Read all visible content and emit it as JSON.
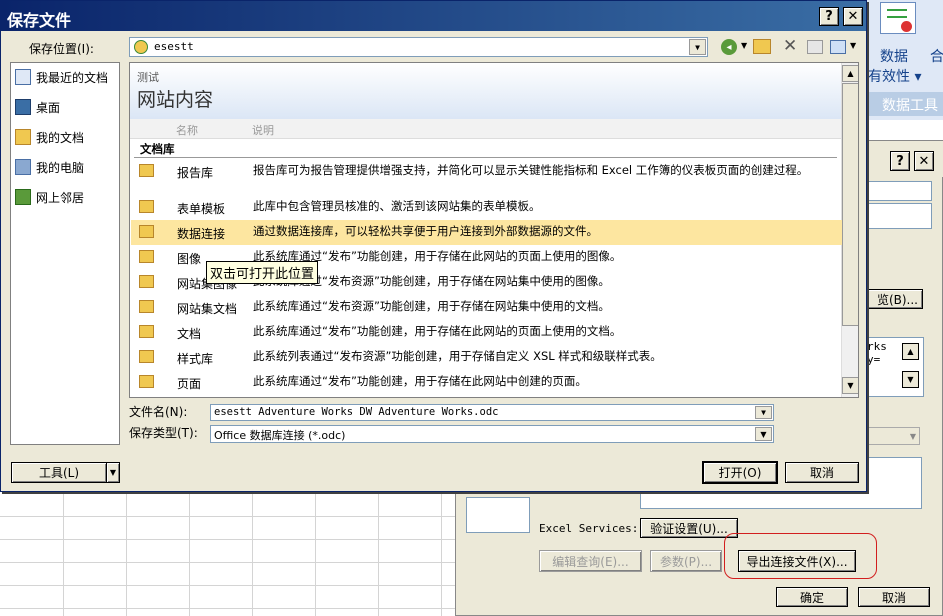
{
  "dialog": {
    "title": "保存文件",
    "help_label": "?",
    "close_label": "✕"
  },
  "save_location": {
    "label": "保存位置(I):",
    "value": "esestt"
  },
  "places": [
    "我最近的文档",
    "桌面",
    "我的文档",
    "我的电脑",
    "网上邻居"
  ],
  "site": {
    "caption": "测试",
    "title": "网站内容",
    "col_name": "名称",
    "col_desc": "说明",
    "section": "文档库"
  },
  "libraries": [
    {
      "name": "报告库",
      "desc": "报告库可为报告管理提供增强支持，并简化可以显示关键性能指标和 Excel 工作簿的仪表板页面的创建过程。"
    },
    {
      "name": "表单模板",
      "desc": "此库中包含管理员核准的、激活到该网站集的表单模板。"
    },
    {
      "name": "数据连接",
      "desc": "通过数据连接库，可以轻松共享便于用户连接到外部数据源的文件。"
    },
    {
      "name": "图像",
      "desc": "此系统库通过“发布”功能创建，用于存储在此网站的页面上使用的图像。"
    },
    {
      "name": "网站集图像",
      "desc": "此系统库通过“发布资源”功能创建，用于存储在网站集中使用的图像。"
    },
    {
      "name": "网站集文档",
      "desc": "此系统库通过“发布资源”功能创建，用于存储在网站集中使用的文档。"
    },
    {
      "name": "文档",
      "desc": "此系统库通过“发布”功能创建，用于存储在此网站的页面上使用的文档。"
    },
    {
      "name": "样式库",
      "desc": "此系统列表通过“发布资源”功能创建，用于存储自定义 XSL 样式和级联样式表。"
    },
    {
      "name": "页面",
      "desc": "此系统库通过“发布”功能创建，用于存储在此网站中创建的页面。"
    }
  ],
  "tooltip": "双击可打开此位置",
  "filename": {
    "label": "文件名(N):",
    "value": "esestt Adventure Works DW Adventure Works.odc"
  },
  "filetype": {
    "label": "保存类型(T):",
    "value": "Office 数据库连接 (*.odc)"
  },
  "buttons": {
    "tools": "工具(L)",
    "open": "打开(O)",
    "cancel": "取消"
  },
  "background": {
    "ribbon_data": "数据",
    "ribbon_he": "合",
    "ribbon_validity": "有效性",
    "ribbon_tools": "数据工具",
    "help_label": "?",
    "close_label": "✕",
    "browse": "览(B)...",
    "list_text": "rks\ny=",
    "excel_services_label": "Excel Services:",
    "auth_settings": "验证设置(U)...",
    "edit_query": "编辑查询(E)...",
    "params": "参数(P)...",
    "export_conn": "导出连接文件(X)...",
    "ok": "确定",
    "cancel": "取消"
  },
  "colors": {
    "title_bar": "#0a246a",
    "highlight": "#fde6a0",
    "dialog_bg": "#ece9d8",
    "annotation": "#d21e1e"
  }
}
